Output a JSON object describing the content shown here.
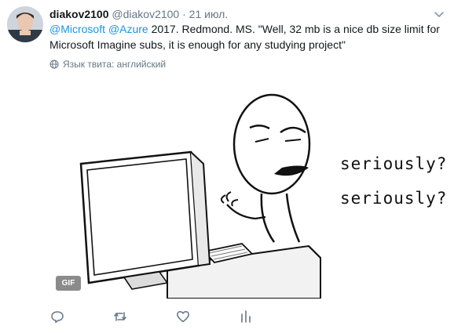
{
  "tweet": {
    "display_name": "diakov2100",
    "handle": "@diakov2100",
    "separator": "·",
    "date": "21 июл.",
    "mention_1": "@Microsoft",
    "mention_2": "@Azure",
    "text_rest": "2017. Redmond. MS. \"Well, 32 mb is a nice db size limit for Microsoft Imagine subs, it is enough for any studying project\"",
    "language_note": "Язык твита: английский"
  },
  "media": {
    "badge": "GIF",
    "drawn_caption_1": "seriously?",
    "drawn_caption_2": "seriously?"
  },
  "colors": {
    "link": "#1b95e0",
    "secondary": "#657786",
    "text": "#14171a"
  },
  "icons": [
    "chevron-down-icon",
    "globe-icon",
    "reply-icon",
    "retweet-icon",
    "like-icon",
    "analytics-icon"
  ]
}
